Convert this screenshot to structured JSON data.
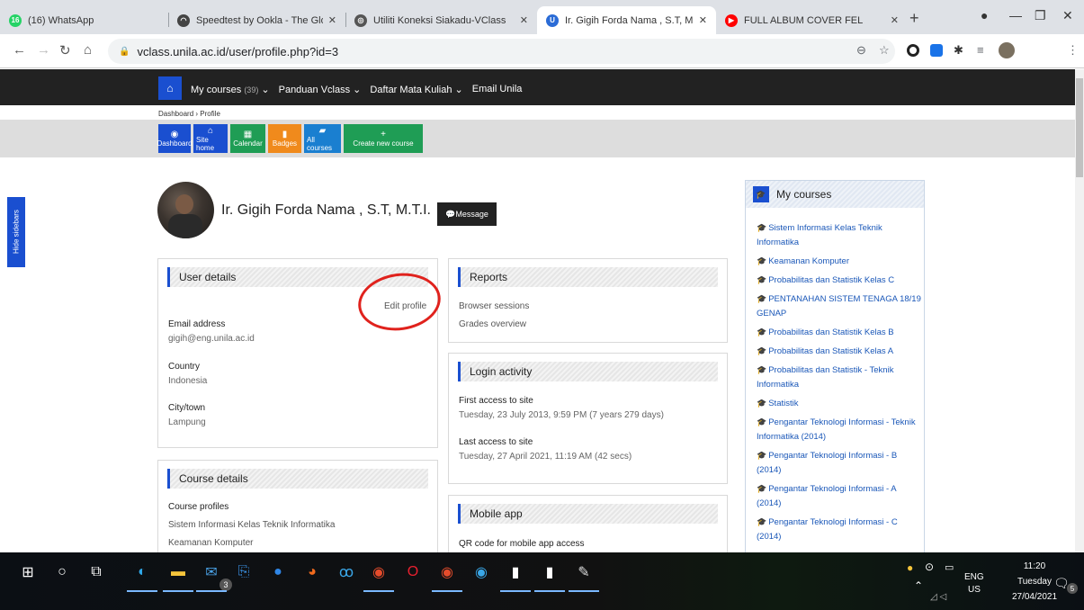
{
  "browser": {
    "tabs": [
      {
        "title": "(16) WhatsApp",
        "favicon_color": "#25d366",
        "favicon_text": "16",
        "active": false,
        "has_close": false
      },
      {
        "title": "Speedtest by Ookla - The Glo",
        "favicon_color": "#444444",
        "favicon_text": "◠",
        "active": false,
        "has_close": true
      },
      {
        "title": "Utiliti Koneksi Siakadu-VClass",
        "favicon_color": "#555555",
        "favicon_text": "◎",
        "active": false,
        "has_close": true
      },
      {
        "title": "Ir. Gigih Forda Nama , S.T, M.",
        "favicon_color": "#2b6cd6",
        "favicon_text": "U",
        "active": true,
        "has_close": true
      },
      {
        "title": "FULL ALBUM COVER FEL",
        "favicon_color": "#ff0000",
        "favicon_text": "▶",
        "active": false,
        "has_close": true
      }
    ],
    "url": "vclass.unila.ac.id/user/profile.php?id=3"
  },
  "site": {
    "nav": {
      "my_courses": "My courses",
      "my_courses_count": "(39)",
      "panduan": "Panduan Vclass",
      "daftar": "Daftar Mata Kuliah",
      "email": "Email Unila"
    },
    "breadcrumb": "Dashboard  ›  Profile",
    "quick_buttons": [
      {
        "label": "Dashboard",
        "color": "#1a4fd0",
        "icon": "◉"
      },
      {
        "label": "Site home",
        "color": "#1a4fd0",
        "icon": "⌂"
      },
      {
        "label": "Calendar",
        "color": "#1f9d55",
        "icon": "▦"
      },
      {
        "label": "Badges",
        "color": "#f08a1c",
        "icon": "▮"
      },
      {
        "label": "All courses",
        "color": "#1a7fd0",
        "icon": "▰"
      },
      {
        "label": "Create new course",
        "color": "#1f9d55",
        "icon": "+"
      }
    ],
    "hide_sidebars": "Hide sidebars"
  },
  "profile": {
    "name": "Ir. Gigih Forda Nama , S.T, M.T.I.",
    "message_button": "💬Message"
  },
  "user_details": {
    "title": "User details",
    "edit_profile": "Edit profile",
    "email_label": "Email address",
    "email_value": "gigih@eng.unila.ac.id",
    "country_label": "Country",
    "country_value": "Indonesia",
    "city_label": "City/town",
    "city_value": "Lampung"
  },
  "course_details": {
    "title": "Course details",
    "profiles_label": "Course profiles",
    "courses": [
      "Sistem Informasi Kelas Teknik Informatika",
      "Keamanan Komputer"
    ]
  },
  "reports": {
    "title": "Reports",
    "browser_sessions": "Browser sessions",
    "grades_overview": "Grades overview"
  },
  "login_activity": {
    "title": "Login activity",
    "first_label": "First access to site",
    "first_value": "Tuesday, 23 July 2013, 9:59 PM  (7 years 279 days)",
    "last_label": "Last access to site",
    "last_value": "Tuesday, 27 April 2021, 11:19 AM  (42 secs)"
  },
  "mobile_app": {
    "title": "Mobile app",
    "qr_label": "QR code for mobile app access"
  },
  "my_courses_block": {
    "title": "My courses",
    "items": [
      "Sistem Informasi Kelas Teknik Informatika",
      "Keamanan Komputer",
      "Probabilitas dan Statistik Kelas C",
      "PENTANAHAN SISTEM TENAGA 18/19 GENAP",
      "Probabilitas dan Statistik Kelas B",
      "Probabilitas dan Statistik Kelas A",
      "Probabilitas dan Statistik - Teknik Informatika",
      "Statistik",
      "Pengantar Teknologi Informasi - Teknik Informatika (2014)",
      "Pengantar Teknologi Informasi - B (2014)",
      "Pengantar Teknologi Informasi - A (2014)",
      "Pengantar Teknologi Informasi - C (2014)"
    ]
  },
  "taskbar": {
    "mail_badge": "3",
    "language": "ENG",
    "region": "US",
    "time": "11:20",
    "day": "Tuesday",
    "date": "27/04/2021",
    "notif_count": "5"
  }
}
